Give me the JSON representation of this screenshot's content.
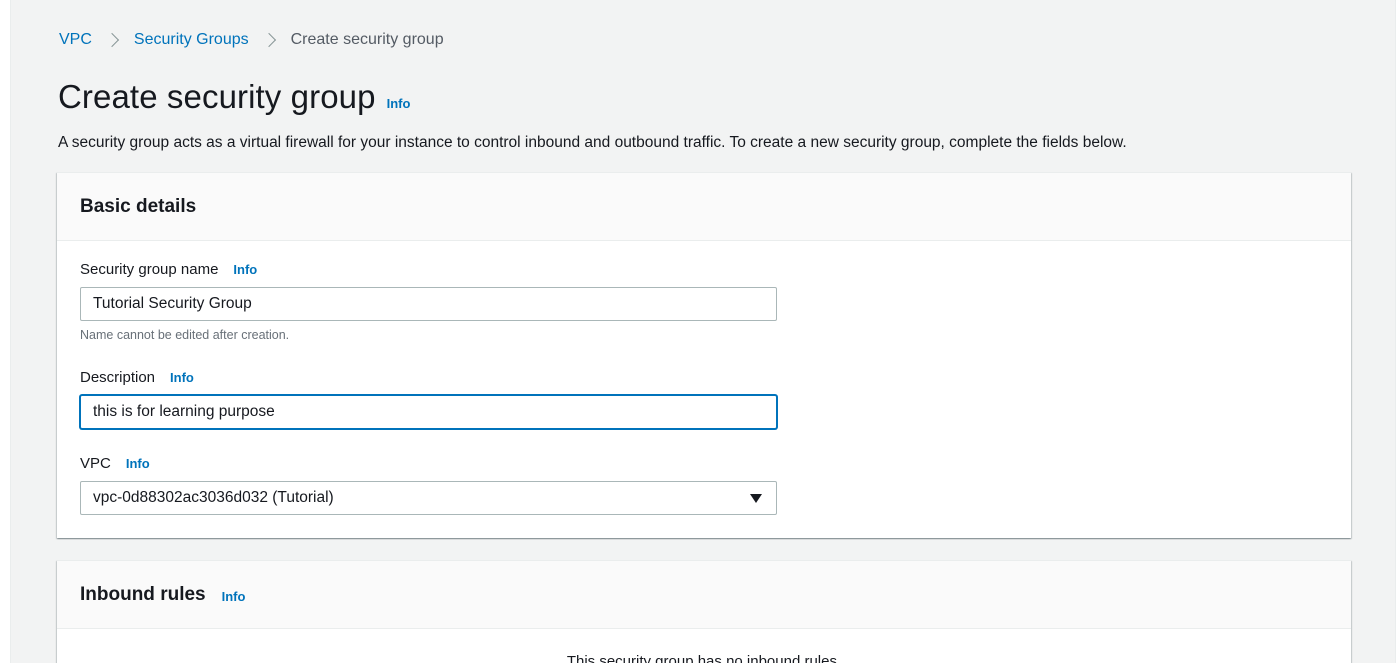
{
  "breadcrumb": {
    "items": [
      "VPC",
      "Security Groups"
    ],
    "current": "Create security group"
  },
  "page": {
    "title": "Create security group",
    "info": "Info",
    "description": "A security group acts as a virtual firewall for your instance to control inbound and outbound traffic. To create a new security group, complete the fields below."
  },
  "basic_details": {
    "title": "Basic details",
    "name_label": "Security group name",
    "name_info": "Info",
    "name_value": "Tutorial Security Group",
    "name_hint": "Name cannot be edited after creation.",
    "description_label": "Description",
    "description_info": "Info",
    "description_value": "this is for learning purpose",
    "vpc_label": "VPC",
    "vpc_info": "Info",
    "vpc_selected": "vpc-0d88302ac3036d032 (Tutorial)"
  },
  "inbound_rules": {
    "title": "Inbound rules",
    "info": "Info",
    "empty_text": "This security group has no inbound rules."
  },
  "colors": {
    "link": "#0073bb",
    "background": "#f2f3f3",
    "text": "#16191f",
    "hint": "#687078",
    "focus": "#0073bb"
  },
  "icons": {
    "breadcrumb_separator": "chevron-right-icon",
    "select_caret": "caret-down-icon"
  }
}
